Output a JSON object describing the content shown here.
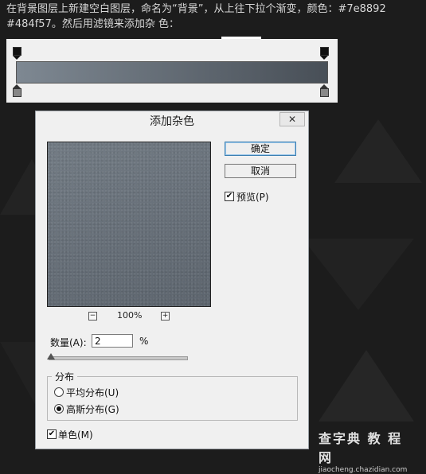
{
  "instruction": {
    "line1": "在背景图层上新建空白图层，命名为“背景”，从上往下拉个渐变，颜色：#7e8892",
    "line2": "#484f57。然后用滤镜来添加杂 色："
  },
  "gradient": {
    "start_color": "#7e8892",
    "end_color": "#484f57"
  },
  "dialog": {
    "title": "添加杂色",
    "close_symbol": "✕",
    "ok_label": "确定",
    "cancel_label": "取消",
    "preview_label": "预览(P)",
    "preview_checked": true,
    "zoom_out_symbol": "−",
    "zoom_in_symbol": "+",
    "zoom_level": "100%",
    "amount_label": "数量(A):",
    "amount_value": "2",
    "amount_unit": "%",
    "distribution": {
      "group_label": "分布",
      "uniform_label": "平均分布(U)",
      "gaussian_label": "高斯分布(G)",
      "selected": "gaussian"
    },
    "monochrome_label": "单色(M)",
    "monochrome_checked": true,
    "check_symbol": "✔"
  },
  "watermark": {
    "main": "查字典 教 程 网",
    "sub": "jiaocheng.chazidian.com"
  }
}
